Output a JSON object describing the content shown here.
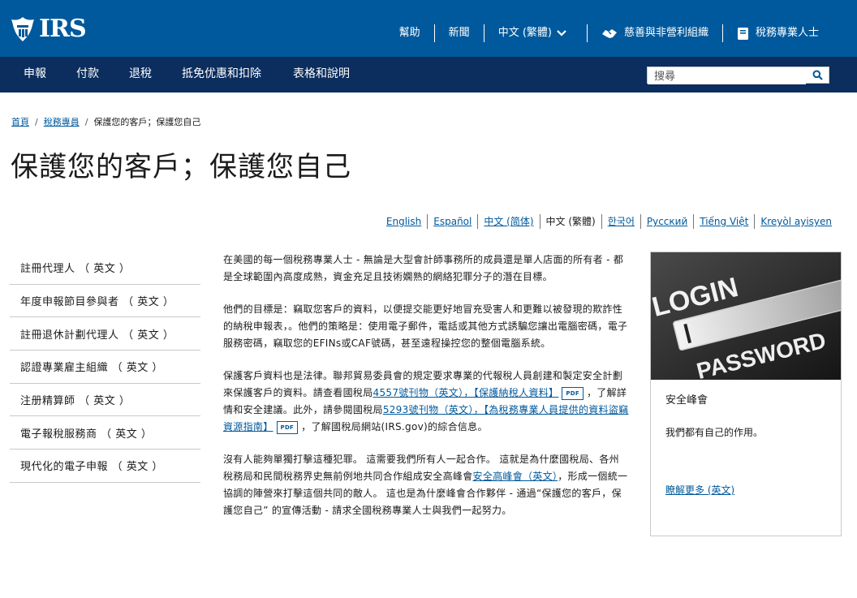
{
  "header": {
    "logo_text": "IRS",
    "links": [
      {
        "label": "幫助"
      },
      {
        "label": "新聞"
      },
      {
        "label": "中文 (繁體)"
      },
      {
        "label": "慈善與非營利組織"
      },
      {
        "label": "稅務專業人士"
      }
    ]
  },
  "nav": {
    "items": [
      "申報",
      "付款",
      "退稅",
      "抵免优惠和扣除",
      "表格和說明"
    ],
    "search_placeholder": "搜尋"
  },
  "breadcrumb": {
    "home": "首頁",
    "section": "稅務專員",
    "current": "保護您的客戶；保護您自己",
    "sep": "/"
  },
  "page_title": "保護您的客戶；保護您自己",
  "languages": [
    {
      "label": "English"
    },
    {
      "label": "Español"
    },
    {
      "label": "中文 (简体)"
    },
    {
      "label": "中文 (繁體)"
    },
    {
      "label": "한국어"
    },
    {
      "label": "Русский"
    },
    {
      "label": "Tiếng Việt"
    },
    {
      "label": "Kreyòl ayisyen"
    }
  ],
  "sidebar": {
    "items": [
      "註冊代理人 （ 英文 ）",
      "年度申報節目參與者 （ 英文 ）",
      "註冊退休計劃代理人 （ 英文 ）",
      "認證專業雇主組織 （ 英文 ）",
      "注册精算師 （ 英文 ）",
      "電子報稅服務商 （ 英文 ）",
      "現代化的電子申報 （ 英文 ）"
    ]
  },
  "content": {
    "p1": "在美國的每一個稅務專業人士 - 無論是大型會計師事務所的成員還是單人店面的所有者 - 都是全球範圍內高度成熟，資金充足且技術嫻熟的網絡犯罪分子的潛在目標。",
    "p2": "他們的目標是：竊取您客戶的資料，以便提交能更好地冒充受害人和更難以被發現的欺詐性的納稅申報表，。他們的策略是：使用電子郵件，電話或其他方式誘騙您讓出電腦密碼，電子服務密碼，竊取您的EFINs或CAF號碼，甚至遠程操控您的整個電腦系統。",
    "p3_a": "保護客戶資料也是法律。聯邦貿易委員會的規定要求專業的代報稅人員創建和製定安全計劃來保護客戶的資料。請查看國稅局",
    "p3_link1": "4557號刊物（英文），【保護納稅人資料】",
    "p3_b": "，了解詳情和安全建議。此外，請參閱國稅局",
    "p3_link2": "5293號刊物（英文），【為稅務專業人員提供的資料盜竊資源指南】",
    "p3_c": "，了解國稅局網站(IRS.gov)的綜合信息。",
    "pdf_label": "PDF",
    "p4_a": "沒有人能夠單獨打擊這種犯罪。 這需要我們所有人一起合作。 這就是為什麼國稅局、各州稅務局和民間稅務界史無前例地共同合作組成安全高峰會",
    "p4_link": "安全高峰會（英文）",
    "p4_b": "，形成一個統一協調的陣營來打擊這個共同的敵人。 這也是為什麼峰會合作夥伴 - 通過“保護您的客戶，保護您自己” 的宣傳活動 - 請求全國稅務專業人士與我們一起努力。"
  },
  "card": {
    "image_text_1": "LOGIN",
    "image_text_2": "PASSWORD",
    "title": "安全峰會",
    "text": "我們都有自己的作用。",
    "link": "瞭解更多 (英文)"
  },
  "colors": {
    "header_blue": "#00599c",
    "nav_navy": "#0b2e5e",
    "link_blue": "#00599c"
  }
}
